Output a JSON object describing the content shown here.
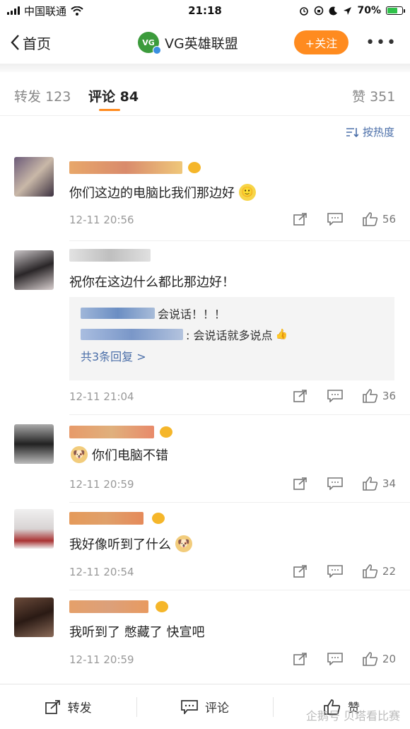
{
  "status": {
    "carrier": "中国联通",
    "time": "21:18",
    "battery": "70%"
  },
  "nav": {
    "back_label": "首页",
    "title": "VG英雄联盟",
    "logo_text": "VG",
    "follow_label": "+关注",
    "more_label": "•••"
  },
  "tabs": [
    {
      "label": "转发",
      "count": "123"
    },
    {
      "label": "评论",
      "count": "84"
    },
    {
      "label": "赞",
      "count": "351"
    }
  ],
  "sort_label": "按热度",
  "comments": [
    {
      "text": "你们这边的电脑比我们那边好",
      "time": "12-11 20:56",
      "likes": "56",
      "emoji": "🙂"
    },
    {
      "text": "祝你在这边什么都比那边好！",
      "time": "12-11 21:04",
      "likes": "36",
      "replies": [
        {
          "text": "会说话！！！"
        },
        {
          "text": ": 会说话就多说点"
        }
      ],
      "more_replies": "共3条回复 >"
    },
    {
      "text": "你们电脑不错",
      "time": "12-11 20:59",
      "likes": "34",
      "emoji": "🐶"
    },
    {
      "text": "我好像听到了什么",
      "time": "12-11 20:54",
      "likes": "22",
      "emoji": "🐶"
    },
    {
      "text": "我听到了 憋藏了 快宣吧",
      "time": "12-11 20:59",
      "likes": "20"
    }
  ],
  "bottom": {
    "repost": "转发",
    "comment": "评论",
    "like": "赞"
  },
  "watermark": "企鹅号 贝塔看比赛"
}
